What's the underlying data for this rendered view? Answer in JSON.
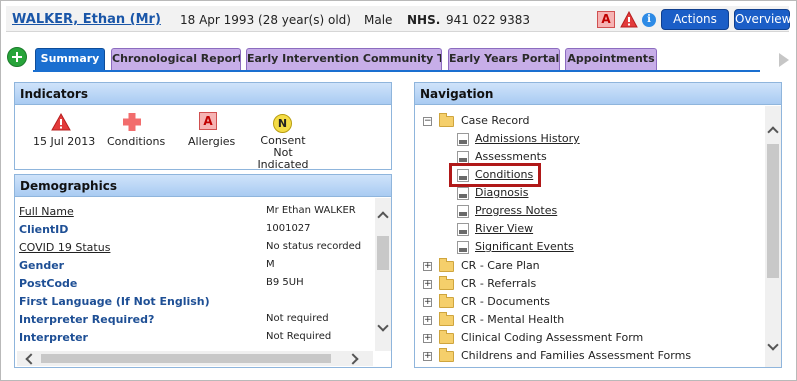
{
  "header": {
    "patient_name": "WALKER, Ethan (Mr)",
    "dob": "18 Apr 1993 (28 year(s) old)",
    "sex": "Male",
    "nhs_label": "NHS.",
    "nhs_number": "941 022 9383",
    "alert_letter": "A",
    "info_glyph": "i",
    "actions_label": "Actions",
    "overview_label": "Overview"
  },
  "tabs": [
    {
      "label": "Summary",
      "active": true
    },
    {
      "label": "Chronological Report"
    },
    {
      "label": "Early Intervention Community T…"
    },
    {
      "label": "Early Years Portal"
    },
    {
      "label": "Appointments"
    }
  ],
  "indicators": {
    "title": "Indicators",
    "items": [
      {
        "label": "15 Jul 2013",
        "icon": "warning-triangle-icon"
      },
      {
        "label": "Conditions",
        "icon": "medical-cross-icon"
      },
      {
        "label": "Allergies",
        "icon": "allergy-a-icon",
        "glyph": "A"
      },
      {
        "label": "Consent Not Indicated",
        "icon": "consent-n-icon",
        "glyph": "N"
      }
    ]
  },
  "demographics": {
    "title": "Demographics",
    "rows": [
      {
        "label": "Full Name",
        "value": "Mr Ethan WALKER"
      },
      {
        "label": "ClientID",
        "value": "1001027"
      },
      {
        "label": "COVID 19 Status",
        "value": "No status recorded"
      },
      {
        "label": "Gender",
        "value": "M"
      },
      {
        "label": "PostCode",
        "value": "B9 5UH"
      },
      {
        "label": "First Language (If Not English)",
        "value": ""
      },
      {
        "label": "Interpreter Required?",
        "value": "Not required"
      },
      {
        "label": "Interpreter",
        "value": "Not Required"
      }
    ]
  },
  "navigation": {
    "title": "Navigation",
    "case_record": {
      "label": "Case Record",
      "children": [
        "Admissions History",
        "Assessments",
        "Conditions",
        "Diagnosis",
        "Progress Notes",
        "River View",
        "Significant Events"
      ]
    },
    "folders": [
      "CR - Care Plan",
      "CR - Referrals",
      "CR - Documents",
      "CR - Mental Health",
      "Clinical Coding Assessment Form",
      "Childrens and Families Assessment Forms"
    ],
    "expand_glyph": "+",
    "collapse_glyph": "−"
  },
  "colors": {
    "accent": "#1a6fd0",
    "tab_inactive": "#c7aee8",
    "highlight": "#b01818"
  }
}
